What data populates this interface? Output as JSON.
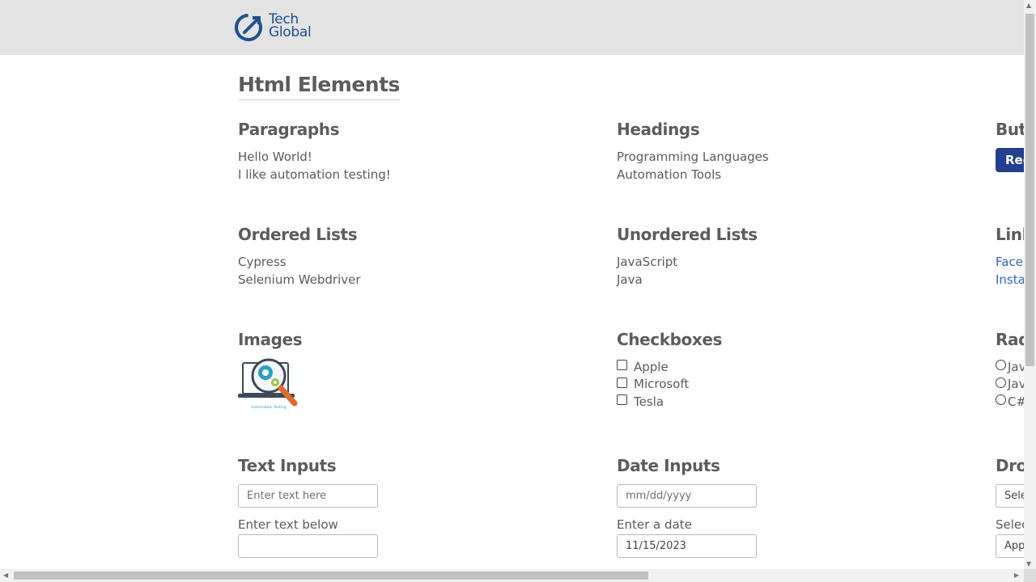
{
  "brand": {
    "line1": "Tech",
    "line2": "Global",
    "accent": "#1d4f91"
  },
  "page_title": "Html Elements",
  "paragraphs": {
    "heading": "Paragraphs",
    "lines": [
      "Hello World!",
      "I like automation testing!"
    ]
  },
  "headings": {
    "heading": "Headings",
    "lines": [
      "Programming Languages",
      "Automation Tools"
    ]
  },
  "buttons": {
    "heading": "Buttons",
    "register_label": "Register"
  },
  "ordered_lists": {
    "heading": "Ordered Lists",
    "items": [
      "Cypress",
      "Selenium Webdriver"
    ]
  },
  "unordered_lists": {
    "heading": "Unordered Lists",
    "items": [
      "JavaScript",
      "Java"
    ]
  },
  "links": {
    "heading": "Links",
    "items": [
      "Facebook",
      "Instagram"
    ]
  },
  "images": {
    "heading": "Images",
    "caption": "Automation Testing"
  },
  "checkboxes": {
    "heading": "Checkboxes",
    "items": [
      "Apple",
      "Microsoft",
      "Tesla"
    ]
  },
  "radio_buttons": {
    "heading": "Radio Buttons",
    "items": [
      "Java",
      "JavaScript",
      "C#"
    ]
  },
  "text_inputs": {
    "heading": "Text Inputs",
    "placeholder": "Enter text here",
    "label": "Enter text below",
    "value": ""
  },
  "date_inputs": {
    "heading": "Date Inputs",
    "placeholder": "mm/dd/yyyy",
    "label": "Enter a date",
    "value": "11/15/2023"
  },
  "dropdowns": {
    "heading": "Dropdowns",
    "select_label": "Select...",
    "label": "Select a company",
    "selected": "Apple"
  },
  "colors": {
    "primary_button": "#23408e",
    "link": "#3560c5"
  }
}
